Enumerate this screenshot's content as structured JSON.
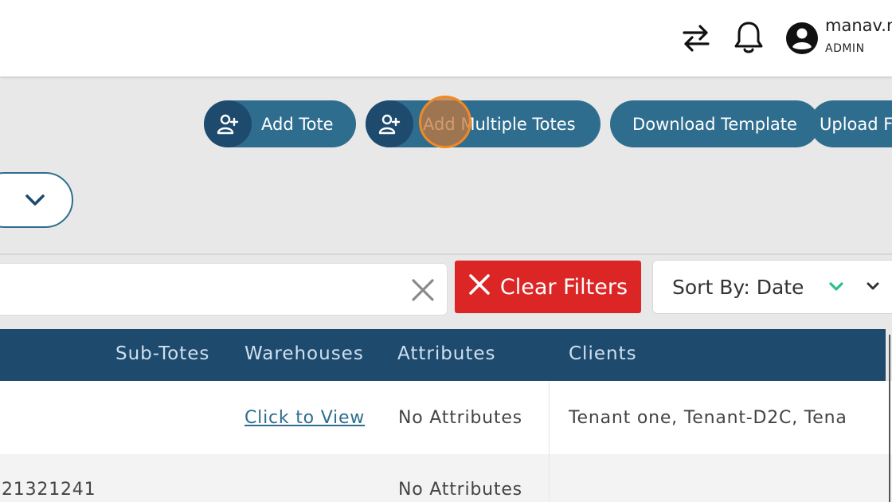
{
  "header": {
    "user_name": "manav.m",
    "user_role": "ADMIN",
    "icons": [
      "swap-arrows-icon",
      "bell-icon",
      "account-circle-icon"
    ]
  },
  "actions": {
    "add_tote": "Add Tote",
    "add_multiple_totes": "Add Multiple Totes",
    "download_template": "Download Template",
    "upload": "Upload F"
  },
  "filters": {
    "search_value": "",
    "clear_filters": "Clear Filters",
    "sort_label": "Sort By: Date"
  },
  "table": {
    "columns": [
      "Sub-Totes",
      "Warehouses",
      "Attributes",
      "Clients"
    ],
    "rows": [
      {
        "id": "",
        "warehouses": "Click to View",
        "attributes": "No Attributes",
        "clients": "Tenant one, Tenant-D2C, Tena"
      },
      {
        "id": "21321241",
        "warehouses": "",
        "attributes": "No Attributes",
        "clients": ""
      }
    ]
  },
  "colors": {
    "primary": "#2f6d8f",
    "primary_dark": "#1e4a6e",
    "danger": "#dc2626",
    "accent_green": "#2bbf8a"
  }
}
